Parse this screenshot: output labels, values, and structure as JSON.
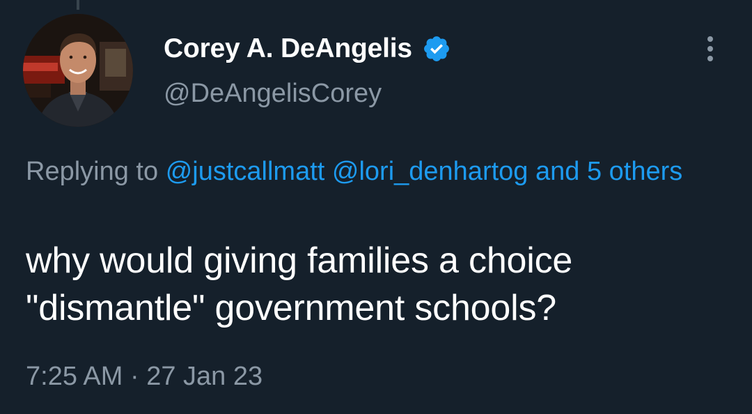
{
  "author": {
    "display_name": "Corey A. DeAngelis",
    "handle": "@DeAngelisCorey",
    "verified": true
  },
  "reply": {
    "prefix": "Replying to",
    "mention_1": "@justcallmatt",
    "mention_2": "@lori_denhartog",
    "others": "and 5 others"
  },
  "tweet": {
    "line_1": "why would giving families a choice",
    "line_2": "\"dismantle\" government schools?"
  },
  "meta": {
    "time": "7:25 AM",
    "separator": "·",
    "date": "27 Jan 23"
  },
  "icons": {
    "verified": "verified-badge-icon",
    "more": "more-options-icon"
  },
  "colors": {
    "background": "#15202b",
    "link": "#1d9bf0",
    "secondary_text": "#8b98a5",
    "primary_text": "#ffffff"
  }
}
